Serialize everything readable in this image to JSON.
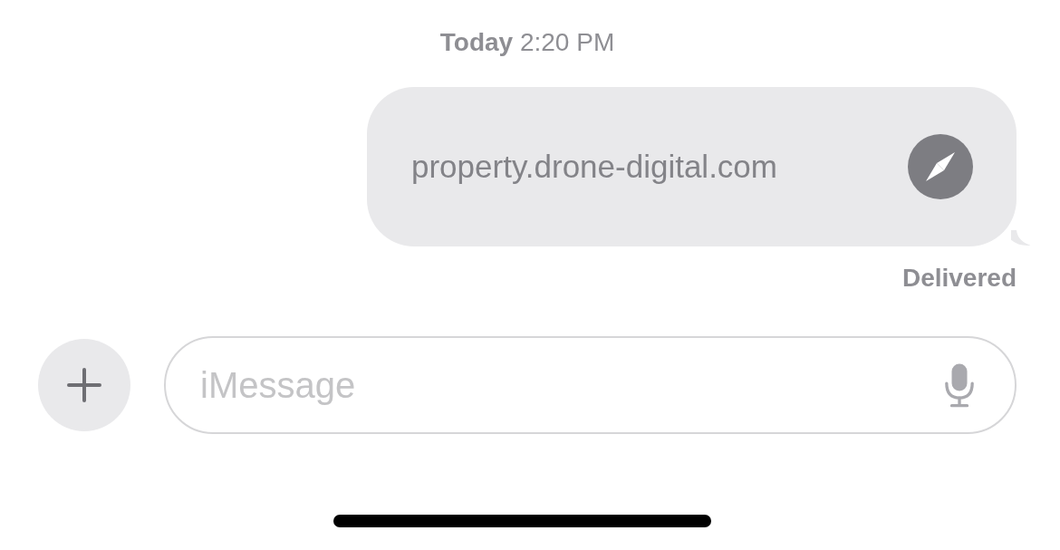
{
  "timestamp": "**Today** 2:20 PM",
  "message": {
    "text": "property.drone-digital.com"
  },
  "status": "Delivered",
  "composer": {
    "placeholder": "iMessage"
  }
}
